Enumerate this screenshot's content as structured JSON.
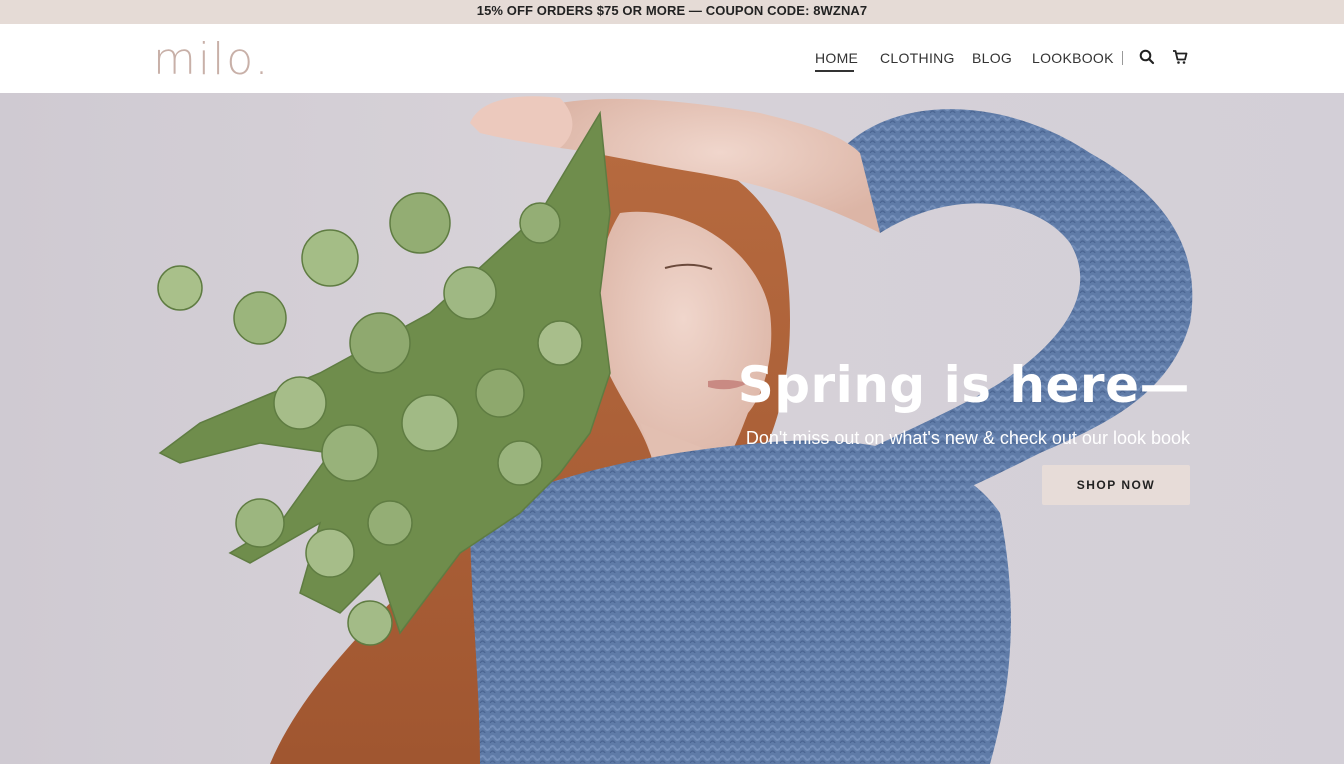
{
  "promo": {
    "text": "15% OFF ORDERS $75 OR MORE — COUPON CODE: 8WZNA7"
  },
  "header": {
    "logo": "milo.",
    "nav": [
      {
        "label": "HOME",
        "active": true
      },
      {
        "label": "CLOTHING"
      },
      {
        "label": "BLOG"
      },
      {
        "label": "LOOKBOOK"
      }
    ],
    "icons": [
      "search-icon",
      "cart-icon"
    ]
  },
  "hero": {
    "title": "Spring is here—",
    "subtitle": "Don't miss out on what's new & check out our look book",
    "button": "SHOP NOW"
  },
  "colors": {
    "promo_bg": "#e5dbd6",
    "logo": "#c8b0a8",
    "button_bg": "#e7dcd8",
    "sweater": "#5e7aa6",
    "hair": "#b9683a",
    "greenery": "#7c9a5a"
  }
}
